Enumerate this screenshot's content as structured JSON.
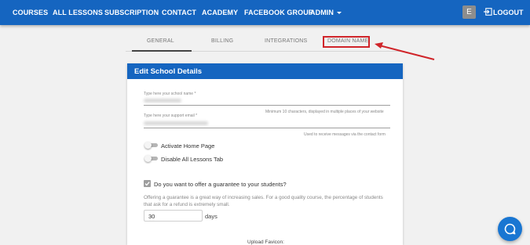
{
  "nav": {
    "items": [
      "COURSES",
      "ALL LESSONS",
      "SUBSCRIPTION",
      "CONTACT",
      "ACADEMY",
      "FACEBOOK GROUP",
      "ADMIN"
    ],
    "avatar_letter": "E",
    "logout_label": "LOGOUT",
    "color": "#1565c0"
  },
  "tabs": {
    "items": [
      "GENERAL",
      "BILLING",
      "INTEGRATIONS",
      "DOMAIN NAME"
    ],
    "active": "GENERAL",
    "highlighted": "DOMAIN NAME",
    "highlight_color": "#d0252a"
  },
  "card": {
    "title": "Edit School Details",
    "school_name": {
      "label": "Type here your school name *",
      "helper": "Minimum 10 characters, displayed in multiple places of your website"
    },
    "support_email": {
      "label": "Type here your support email *",
      "helper": "Used to receive messages via the contact form"
    },
    "toggles": [
      {
        "label": "Activate Home Page",
        "on": false
      },
      {
        "label": "Disable All Lessons Tab",
        "on": false
      }
    ],
    "guarantee": {
      "label": "Do you want to offer a guarantee to your students?",
      "checked": true,
      "description": "Offering a guarantee is a great way of increasing sales. For a good quality course, the percentage of students that ask for a refund is extremely small.",
      "days_value": "30",
      "days_label": "days"
    },
    "upload_favicon_label": "Upload Favicon:"
  },
  "icons": {
    "logout": "logout-icon",
    "chat": "chat-bubble-icon",
    "admin_dropdown": "chevron-down-icon"
  }
}
